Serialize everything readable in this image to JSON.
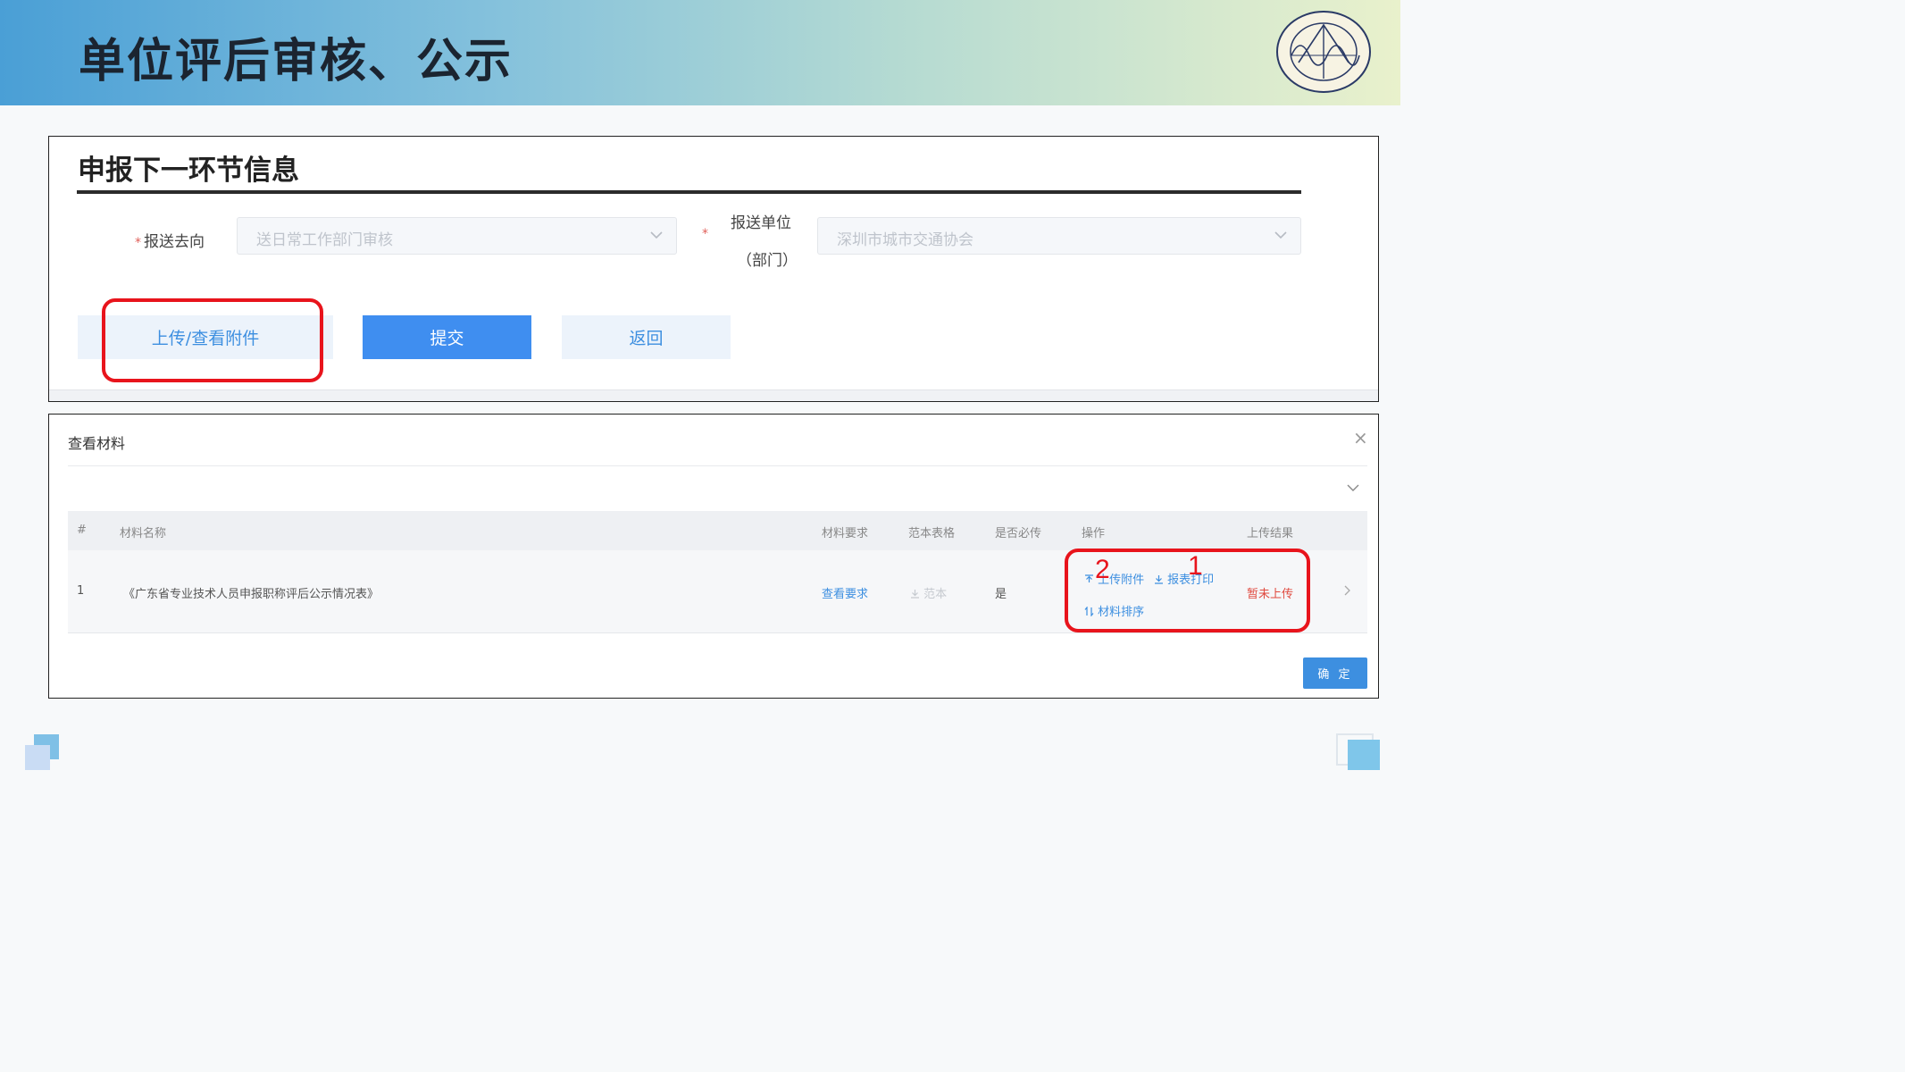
{
  "slide": {
    "title": "单位评后审核、公示"
  },
  "form_panel": {
    "title": "申报下一环节信息",
    "required_mark": "*",
    "send_direction": {
      "label": "报送去向",
      "value": "送日常工作部门审核"
    },
    "send_unit": {
      "label_line1": "报送单位",
      "label_line2": "（部门）",
      "value": "深圳市城市交通协会"
    },
    "buttons": {
      "upload": "上传/查看附件",
      "submit": "提交",
      "back": "返回"
    }
  },
  "dialog": {
    "title": "查看材料",
    "close": "×",
    "columns": [
      "#",
      "材料名称",
      "材料要求",
      "范本表格",
      "是否必传",
      "操作",
      "上传结果"
    ],
    "rows": [
      {
        "index": "1",
        "name": "《广东省专业技术人员申报职称评后公示情况表》",
        "requirement": "查看要求",
        "template": "范本",
        "required": "是",
        "op_upload": "上传附件",
        "op_print": "报表打印",
        "op_sort": "材料排序",
        "result": "暂未上传"
      }
    ],
    "confirm": "确 定"
  },
  "annotations": {
    "label_1": "1",
    "label_2": "2",
    "color": "#e8141c"
  },
  "colors": {
    "accent": "#3f8ef0",
    "link": "#3d8fe0",
    "danger": "#e04a3f"
  }
}
